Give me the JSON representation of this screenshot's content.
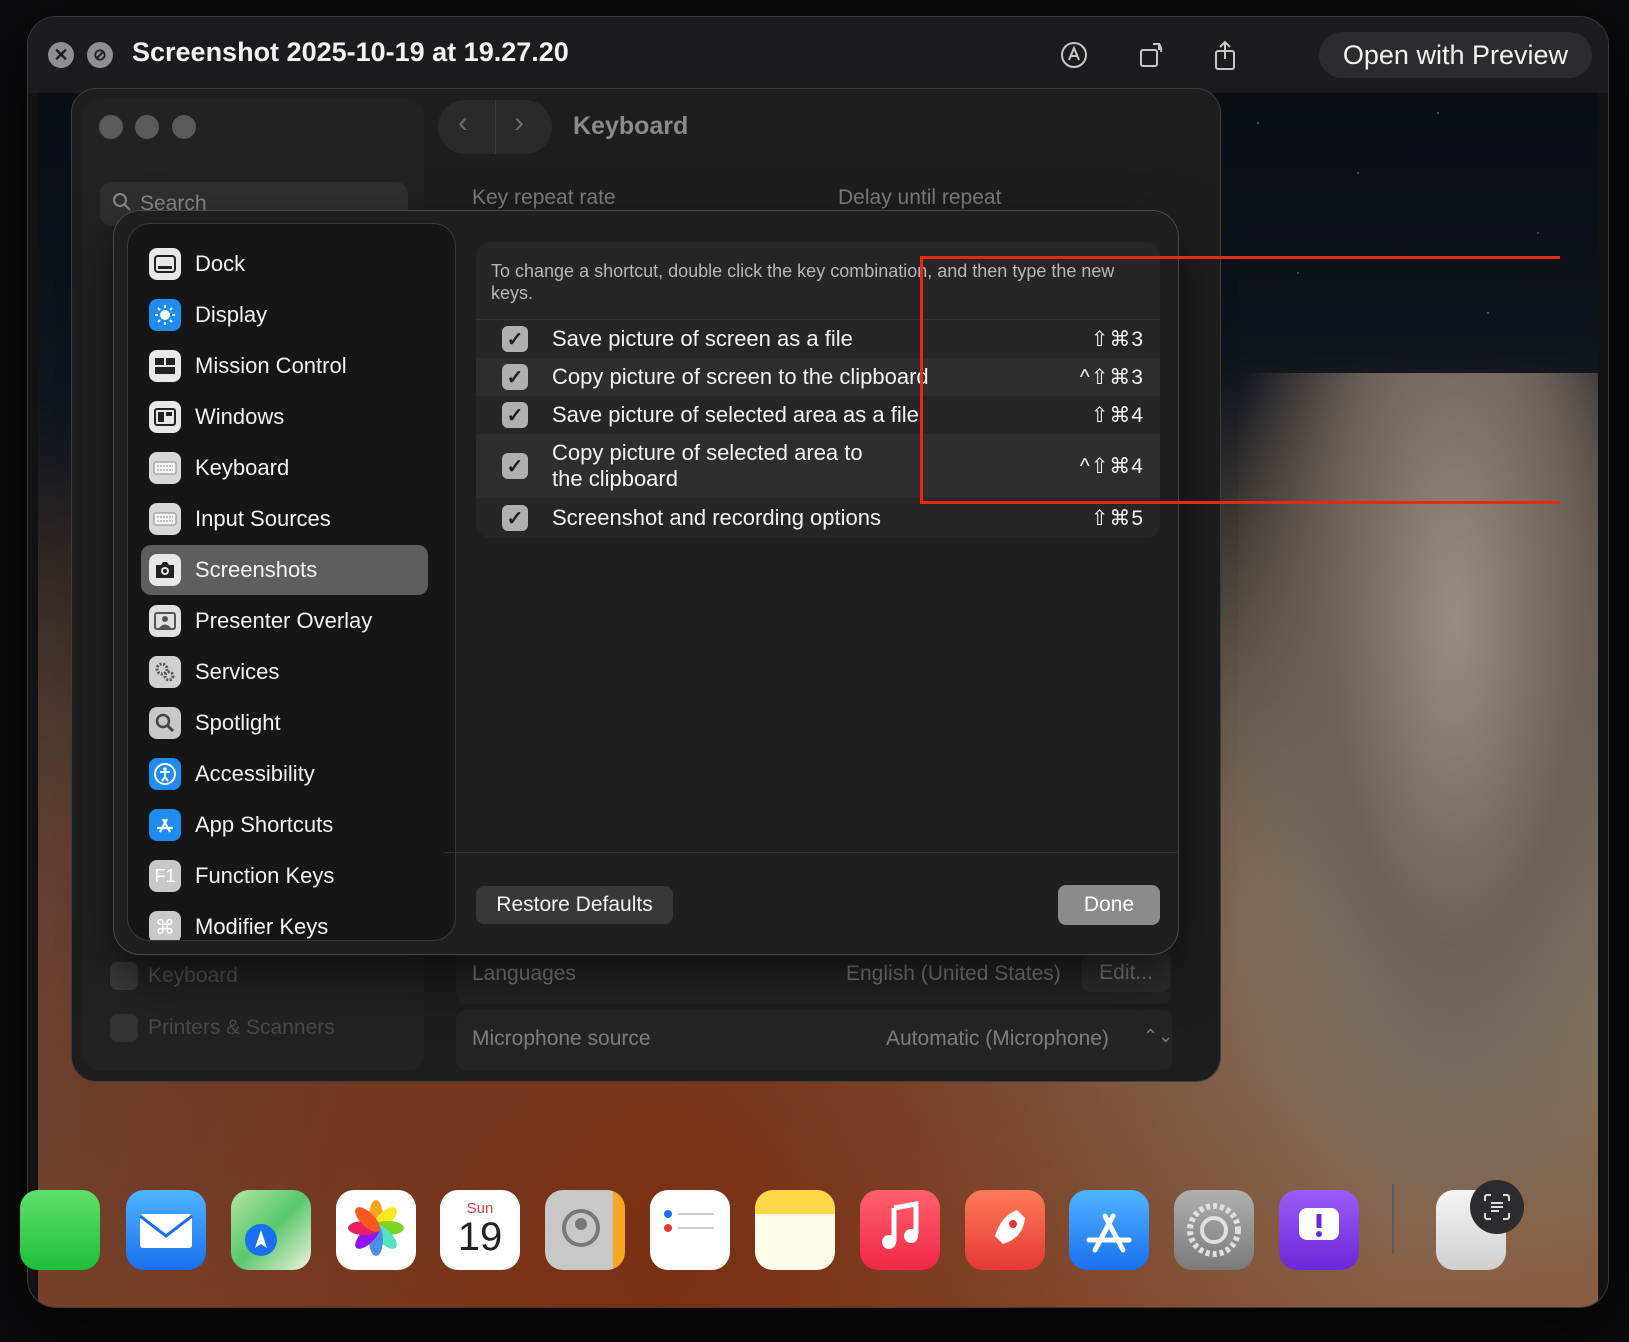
{
  "quicklook": {
    "title": "Screenshot 2025-10-19 at 19.27.20",
    "open_button": "Open with Preview",
    "close_glyph": "✕",
    "fullscreen_glyph": "⊘"
  },
  "system_settings": {
    "title": "Keyboard",
    "back_glyph": "‹",
    "forward_glyph": "›",
    "search_placeholder": "Search",
    "key_repeat_label": "Key repeat rate",
    "delay_repeat_label": "Delay until repeat",
    "languages_label": "Languages",
    "languages_value": "English (United States)",
    "languages_edit": "Edit...",
    "microphone_label": "Microphone source",
    "microphone_value": "Automatic (Microphone)",
    "sidebar_under": [
      "Keyboard",
      "Printers & Scanners"
    ]
  },
  "sheet": {
    "sidebar": [
      {
        "label": "Dock",
        "icon": "dock-icon"
      },
      {
        "label": "Display",
        "icon": "display-icon"
      },
      {
        "label": "Mission Control",
        "icon": "mission-control-icon"
      },
      {
        "label": "Windows",
        "icon": "windows-icon"
      },
      {
        "label": "Keyboard",
        "icon": "keyboard-icon"
      },
      {
        "label": "Input Sources",
        "icon": "input-sources-icon"
      },
      {
        "label": "Screenshots",
        "icon": "camera-icon",
        "selected": true
      },
      {
        "label": "Presenter Overlay",
        "icon": "presenter-overlay-icon"
      },
      {
        "label": "Services",
        "icon": "gears-icon"
      },
      {
        "label": "Spotlight",
        "icon": "magnifier-icon"
      },
      {
        "label": "Accessibility",
        "icon": "accessibility-icon"
      },
      {
        "label": "App Shortcuts",
        "icon": "app-store-icon"
      },
      {
        "label": "Function Keys",
        "icon": "function-key-icon"
      },
      {
        "label": "Modifier Keys",
        "icon": "command-icon"
      }
    ],
    "hint": "To change a shortcut, double click the key combination, and then type the new keys.",
    "shortcuts": [
      {
        "label": "Save picture of screen as a file",
        "keys": "⇧⌘3",
        "checked": true
      },
      {
        "label": "Copy picture of screen to the clipboard",
        "keys": "^⇧⌘3",
        "checked": true
      },
      {
        "label": "Save picture of selected area as a file",
        "keys": "⇧⌘4",
        "checked": true
      },
      {
        "label": "Copy picture of selected area to the clipboard",
        "keys": "^⇧⌘4",
        "checked": true
      },
      {
        "label": "Screenshot and recording options",
        "keys": "⇧⌘5",
        "checked": true
      }
    ],
    "check_glyph": "✓",
    "restore_label": "Restore Defaults",
    "done_label": "Done"
  },
  "dock": {
    "calendar_day": "Sun",
    "calendar_date": "19",
    "apps": [
      "messages-icon",
      "mail-icon",
      "maps-icon",
      "photos-icon",
      "calendar-icon",
      "contacts-icon",
      "reminders-icon",
      "notes-icon",
      "music-icon",
      "rocket-icon",
      "app-store-icon",
      "system-settings-icon",
      "feedback-icon",
      "downloads-icon"
    ]
  },
  "colors": {
    "annotation": "#e32a12",
    "selected": "#5e5e5e",
    "display_blue": "#1e8cf0"
  }
}
